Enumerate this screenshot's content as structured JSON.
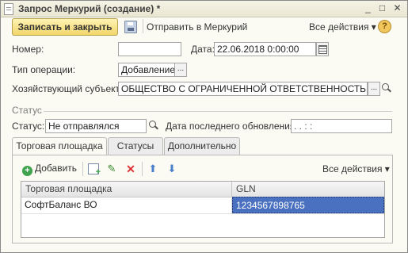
{
  "window": {
    "title": "Запрос Меркурий (создание) *",
    "controls": {
      "minimize": "_",
      "maximize": "□",
      "close": "✕"
    }
  },
  "toolbar": {
    "save_close_label": "Записать и закрыть",
    "send_label": "Отправить в Меркурий",
    "all_actions_label": "Все действия ▾",
    "help_label": "?"
  },
  "form": {
    "number_label": "Номер:",
    "number_value": "",
    "date_label": "Дата:",
    "date_value": "22.06.2018  0:00:00",
    "op_type_label": "Тип операции:",
    "op_type_value": "Добавление",
    "subject_label": "Хозяйствующий субъект:",
    "subject_value": "ОБЩЕСТВО С ОГРАНИЧЕННОЙ ОТВЕТСТВЕННОСТЬЮ \"ГК \"",
    "ellipsis": "..."
  },
  "status_group": {
    "title": "Статус",
    "status_label": "Статус:",
    "status_value": "Не отправлялся",
    "last_update_label": "Дата последнего обновления:",
    "last_update_value": " .  .       :  :"
  },
  "tabs": [
    {
      "label": "Торговая площадка",
      "active": true
    },
    {
      "label": "Статусы",
      "active": false
    },
    {
      "label": "Дополнительно",
      "active": false
    }
  ],
  "panel_toolbar": {
    "add_label": "Добавить",
    "all_actions_label": "Все действия ▾",
    "icons": [
      "add-icon",
      "copy-icon",
      "edit-icon",
      "delete-icon",
      "move-up-icon",
      "move-down-icon"
    ]
  },
  "grid": {
    "columns": [
      "Торговая площадка",
      "GLN"
    ],
    "rows": [
      {
        "site": "СофтБаланс ВО",
        "gln": "1234567898765"
      }
    ]
  },
  "colors": {
    "primary_button": "#f2d66b",
    "selection": "#4a70c0",
    "add_icon": "#3fa34d",
    "delete_icon": "#dd3333"
  }
}
